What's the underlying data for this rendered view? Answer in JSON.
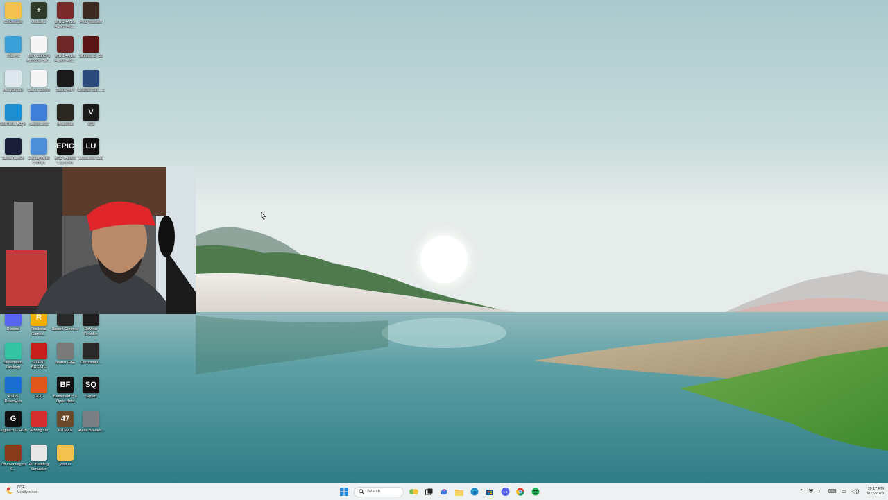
{
  "desktop": {
    "icons": [
      {
        "label": "Chickenpix",
        "glyph": "folder-icon",
        "color": "#f2c14e",
        "text": ""
      },
      {
        "label": "Outlast 2",
        "glyph": "outlast-icon",
        "color": "#2e3a2a",
        "text": "+"
      },
      {
        "label": "WUCHANG Fallen Fea...",
        "glyph": "wuchang-icon",
        "color": "#7a2b2b",
        "text": ""
      },
      {
        "label": "Find Yourself",
        "glyph": "find-yourself-icon",
        "color": "#3a2a22",
        "text": ""
      },
      {
        "label": "This PC",
        "glyph": "monitor-icon",
        "color": "#3aa0d8",
        "text": ""
      },
      {
        "label": "Tom Clancy's Rainbow Six...",
        "glyph": "file-icon",
        "color": "#f5f5f5",
        "text": ""
      },
      {
        "label": "WUCHANG Fallen Fea...",
        "glyph": "wuchang-icon",
        "color": "#6e2626",
        "text": ""
      },
      {
        "label": "Sinners of '33",
        "glyph": "game-icon",
        "color": "#5a1414",
        "text": ""
      },
      {
        "label": "Recycle Bin",
        "glyph": "recycle-bin-icon",
        "color": "#dfe8ef",
        "text": ""
      },
      {
        "label": "Call of Duty®",
        "glyph": "file-icon",
        "color": "#f5f5f5",
        "text": ""
      },
      {
        "label": "Silent Hill f",
        "glyph": "silent-hill-icon",
        "color": "#1a1a1a",
        "text": ""
      },
      {
        "label": "Counter-Stri... 2",
        "glyph": "cs2-icon",
        "color": "#2b4a7c",
        "text": ""
      },
      {
        "label": "Microsoft Edge",
        "glyph": "edge-icon",
        "color": "#1d8fd1",
        "text": ""
      },
      {
        "label": "GameLoop",
        "glyph": "gameloop-icon",
        "color": "#3f7fd8",
        "text": ""
      },
      {
        "label": "Reanimal",
        "glyph": "reanimal-icon",
        "color": "#2a2622",
        "text": ""
      },
      {
        "label": "Vigil",
        "glyph": "vigil-icon",
        "color": "#1a1a1a",
        "text": "V"
      },
      {
        "label": "Stream Deck",
        "glyph": "stream-deck-icon",
        "color": "#1b1f3a",
        "text": ""
      },
      {
        "label": "DisplayWrite Control",
        "glyph": "display-icon",
        "color": "#4d8fd8",
        "text": ""
      },
      {
        "label": "Epic Games Launcher",
        "glyph": "epic-games-icon",
        "color": "#111",
        "text": "EPIC"
      },
      {
        "label": "LossLess Clip",
        "glyph": "lossless-icon",
        "color": "#111",
        "text": "LU"
      },
      {
        "label": "Discord",
        "glyph": "discord-icon",
        "color": "#5865f2",
        "text": ""
      },
      {
        "label": "Rockstar Games...",
        "glyph": "rockstar-icon",
        "color": "#f6b100",
        "text": "R"
      },
      {
        "label": "Ubisoft Connect",
        "glyph": "ubisoft-icon",
        "color": "#2a2a2a",
        "text": ""
      },
      {
        "label": "DaVinci Resolve",
        "glyph": "davinci-icon",
        "color": "#1e1e1e",
        "text": ""
      },
      {
        "label": "Streamlabs Desktop",
        "glyph": "streamlabs-icon",
        "color": "#31c3a2",
        "text": ""
      },
      {
        "label": "SILENT BREATH",
        "glyph": "silent-breath-icon",
        "color": "#c81e1e",
        "text": ""
      },
      {
        "label": "Idatsu 目標",
        "glyph": "idatsu-icon",
        "color": "#7a7a7a",
        "text": ""
      },
      {
        "label": "Demonolo...",
        "glyph": "demonologist-icon",
        "color": "#2a2a2a",
        "text": ""
      },
      {
        "label": "ASUS DriverHub",
        "glyph": "asus-icon",
        "color": "#1b6fd1",
        "text": ""
      },
      {
        "label": "GCC",
        "glyph": "gcc-icon",
        "color": "#e0561b",
        "text": ""
      },
      {
        "label": "Battlefield™ 6 Open Beta",
        "glyph": "battlefield-icon",
        "color": "#111",
        "text": "BF"
      },
      {
        "label": "Squad",
        "glyph": "squad-icon",
        "color": "#111",
        "text": "SQ"
      },
      {
        "label": "Logitech G HUB",
        "glyph": "logitech-icon",
        "color": "#101010",
        "text": "G"
      },
      {
        "label": "Among Us",
        "glyph": "among-us-icon",
        "color": "#d62e2e",
        "text": ""
      },
      {
        "label": "HITMAN",
        "glyph": "hitman-icon",
        "color": "#6b4a2b",
        "text": "47"
      },
      {
        "label": "Arena Breako...",
        "glyph": "arena-breakout-icon",
        "color": "#7a7f84",
        "text": ""
      },
      {
        "label": "I'm counting to 6...",
        "glyph": "game-icon",
        "color": "#8a3b1a",
        "text": ""
      },
      {
        "label": "PC Building Simulator",
        "glyph": "pc-building-icon",
        "color": "#e8e8e8",
        "text": ""
      },
      {
        "label": "youtub",
        "glyph": "folder-icon",
        "color": "#f2c14e",
        "text": ""
      }
    ]
  },
  "taskbar": {
    "weather": {
      "temp": "77°F",
      "condition": "Mostly clear"
    },
    "search": {
      "placeholder": "Search"
    },
    "pinned": [
      "start-icon",
      "search-icon",
      "widgets-icon",
      "task-view-icon",
      "copilot-icon",
      "file-explorer-icon",
      "edge-icon",
      "store-icon",
      "discord-icon",
      "chrome-icon",
      "spotify-icon"
    ],
    "clock": {
      "time": "10:17 PM",
      "date": "9/22/2025"
    }
  },
  "colors": {
    "taskbar_bg": "#eef1f2",
    "accent": "#0067c0"
  }
}
